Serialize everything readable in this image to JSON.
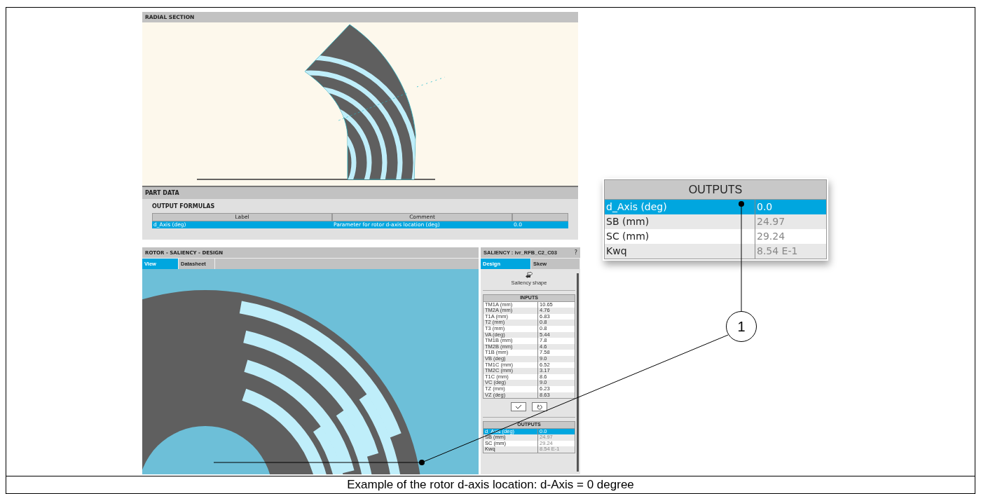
{
  "radial_section": {
    "title": "RADIAL SECTION"
  },
  "part_data": {
    "title": "PART DATA",
    "section_title": "OUTPUT FORMULAS",
    "columns": [
      "Label",
      "Comment"
    ],
    "rows": [
      {
        "cells": [
          "d_Axis (deg)",
          "Parameter for rotor d-axis location (deg)",
          "0.0"
        ],
        "selected": true
      }
    ]
  },
  "rotor_panel": {
    "title": "ROTOR - SALIENCY - DESIGN",
    "tabs": [
      {
        "label": "View",
        "selected": true
      },
      {
        "label": "Datasheet",
        "selected": false
      }
    ]
  },
  "saliency_panel": {
    "title": "SALIENCY : ivr_RFB_C2_C03",
    "help": "?",
    "tabs": [
      {
        "label": "Design",
        "selected": true
      },
      {
        "label": "Skew",
        "selected": false
      }
    ],
    "shape_button": "Saliency shape",
    "inputs": {
      "title": "INPUTS",
      "rows": [
        {
          "label": "TM1A (mm)",
          "value": "10.65"
        },
        {
          "label": "TM2A (mm)",
          "value": "4.76"
        },
        {
          "label": "T1A (mm)",
          "value": "6.83"
        },
        {
          "label": "T2 (mm)",
          "value": "0.8"
        },
        {
          "label": "T3 (mm)",
          "value": "0.8"
        },
        {
          "label": "VA (deg)",
          "value": "5.44"
        },
        {
          "label": "TM1B (mm)",
          "value": "7.8"
        },
        {
          "label": "TM2B (mm)",
          "value": "4.6"
        },
        {
          "label": "T1B (mm)",
          "value": "7.58"
        },
        {
          "label": "VB (deg)",
          "value": "9.0"
        },
        {
          "label": "TM1C (mm)",
          "value": "6.52"
        },
        {
          "label": "TM2C (mm)",
          "value": "3.17"
        },
        {
          "label": "T1C (mm)",
          "value": "8.6"
        },
        {
          "label": "VC (deg)",
          "value": "9.0"
        },
        {
          "label": "TZ (mm)",
          "value": "6.23"
        },
        {
          "label": "VZ (deg)",
          "value": "8.63"
        }
      ]
    },
    "outputs": {
      "title": "OUTPUTS",
      "rows": [
        {
          "label": "d_Axis (deg)",
          "value": "0.0",
          "selected": true
        },
        {
          "label": "SB (mm)",
          "value": "24.97",
          "selected": false
        },
        {
          "label": "SC (mm)",
          "value": "29.24",
          "selected": false
        },
        {
          "label": "Kwq",
          "value": "8.54 E-1",
          "selected": false
        }
      ]
    }
  },
  "zoom_callout": {
    "title": "OUTPUTS",
    "rows": [
      {
        "label": "d_Axis (deg)",
        "value": "0.0",
        "selected": true
      },
      {
        "label": "SB (mm)",
        "value": "24.97",
        "selected": false
      },
      {
        "label": "SC (mm)",
        "value": "29.24",
        "selected": false
      },
      {
        "label": "Kwq",
        "value": "8.54 E-1",
        "selected": false
      }
    ]
  },
  "callout_number": "1",
  "caption": "Example of the rotor d-axis location: d-Axis = 0 degree"
}
